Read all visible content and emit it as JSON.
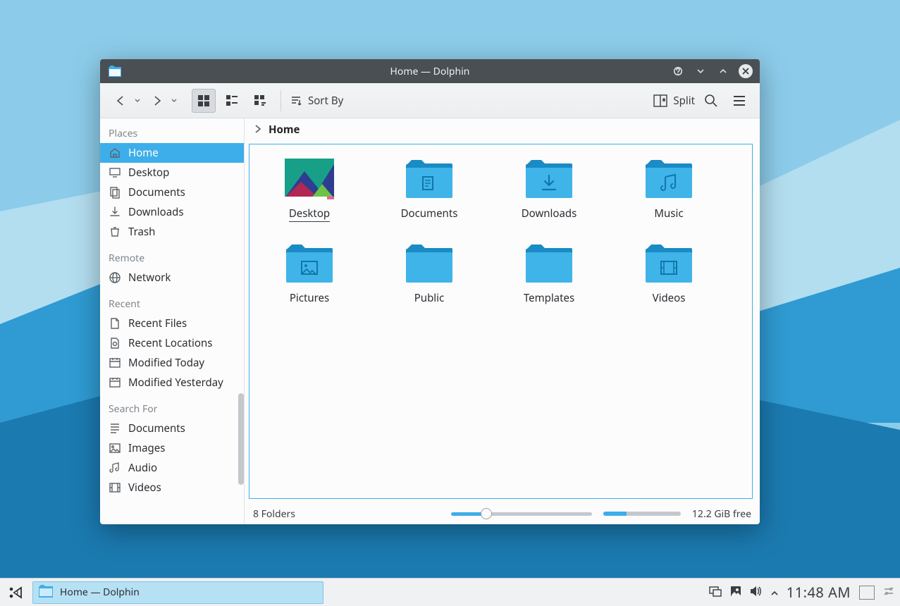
{
  "window": {
    "title": "Home — Dolphin",
    "toolbar": {
      "sort_label": "Sort By",
      "split_label": "Split"
    }
  },
  "breadcrumb": {
    "segment": "Home"
  },
  "sidebar": {
    "sections": [
      {
        "header": "Places",
        "items": [
          {
            "icon": "home",
            "label": "Home",
            "active": true
          },
          {
            "icon": "desktop",
            "label": "Desktop"
          },
          {
            "icon": "documents",
            "label": "Documents"
          },
          {
            "icon": "download",
            "label": "Downloads"
          },
          {
            "icon": "trash",
            "label": "Trash"
          }
        ]
      },
      {
        "header": "Remote",
        "items": [
          {
            "icon": "network",
            "label": "Network"
          }
        ]
      },
      {
        "header": "Recent",
        "items": [
          {
            "icon": "file",
            "label": "Recent Files"
          },
          {
            "icon": "location",
            "label": "Recent Locations"
          },
          {
            "icon": "calendar",
            "label": "Modified Today"
          },
          {
            "icon": "calendar",
            "label": "Modified Yesterday"
          }
        ]
      },
      {
        "header": "Search For",
        "items": [
          {
            "icon": "doclines",
            "label": "Documents"
          },
          {
            "icon": "image",
            "label": "Images"
          },
          {
            "icon": "audio",
            "label": "Audio"
          },
          {
            "icon": "video",
            "label": "Videos"
          }
        ]
      }
    ]
  },
  "files": [
    {
      "name": "Desktop",
      "kind": "desktop-thumb",
      "selected": true
    },
    {
      "name": "Documents",
      "kind": "folder-doc"
    },
    {
      "name": "Downloads",
      "kind": "folder-download"
    },
    {
      "name": "Music",
      "kind": "folder-music"
    },
    {
      "name": "Pictures",
      "kind": "folder-pictures"
    },
    {
      "name": "Public",
      "kind": "folder"
    },
    {
      "name": "Templates",
      "kind": "folder"
    },
    {
      "name": "Videos",
      "kind": "folder-video"
    }
  ],
  "status": {
    "count_text": "8 Folders",
    "free_text": "12.2 GiB free"
  },
  "taskbar": {
    "app_label": "Home — Dolphin",
    "clock": "11:48 AM"
  }
}
